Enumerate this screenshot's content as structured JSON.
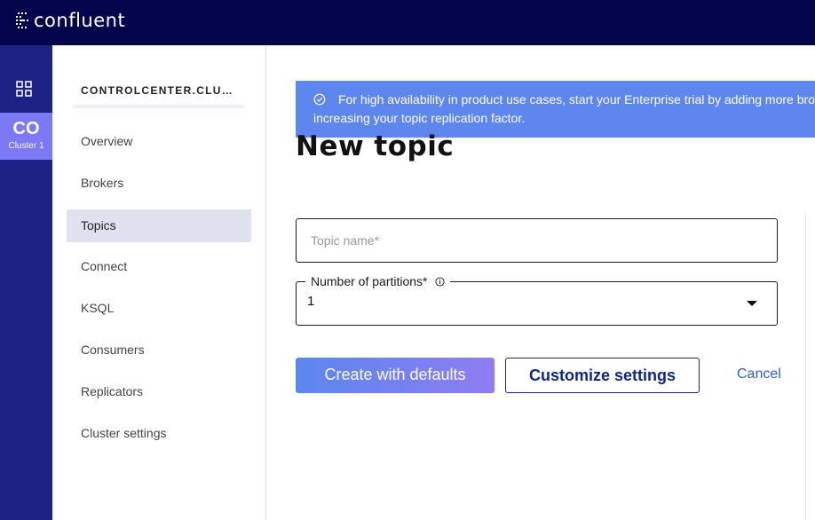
{
  "header": {
    "logo_text": "confluent"
  },
  "rail": {
    "grid_icon": "grid-icon",
    "cluster_abbr": "CO",
    "cluster_name": "Cluster 1"
  },
  "sidebar": {
    "cluster_title": "CONTROLCENTER.CLUSTER",
    "items": [
      {
        "label": "Overview",
        "active": false
      },
      {
        "label": "Brokers",
        "active": false
      },
      {
        "label": "Topics",
        "active": true
      },
      {
        "label": "Connect",
        "active": false
      },
      {
        "label": "KSQL",
        "active": false
      },
      {
        "label": "Consumers",
        "active": false
      },
      {
        "label": "Replicators",
        "active": false
      },
      {
        "label": "Cluster settings",
        "active": false
      }
    ]
  },
  "banner": {
    "icon": "check-circle-icon",
    "text": "For high availability in product use cases, start your Enterprise trial by adding more brok increasing your topic replication factor."
  },
  "form": {
    "title": "New topic",
    "topic_name_placeholder": "Topic name*",
    "partitions_label": "Number of partitions*",
    "partitions_value": "1",
    "create_label": "Create with defaults",
    "customize_label": "Customize settings",
    "cancel_label": "Cancel"
  },
  "colors": {
    "topbar": "#04044d",
    "rail": "#1c2384",
    "cluster_tile": "#7d78f4",
    "banner": "#5e86ef",
    "primary_gradient_start": "#5a87ef",
    "primary_gradient_end": "#8f7cf3",
    "link": "#2f5ed6"
  }
}
